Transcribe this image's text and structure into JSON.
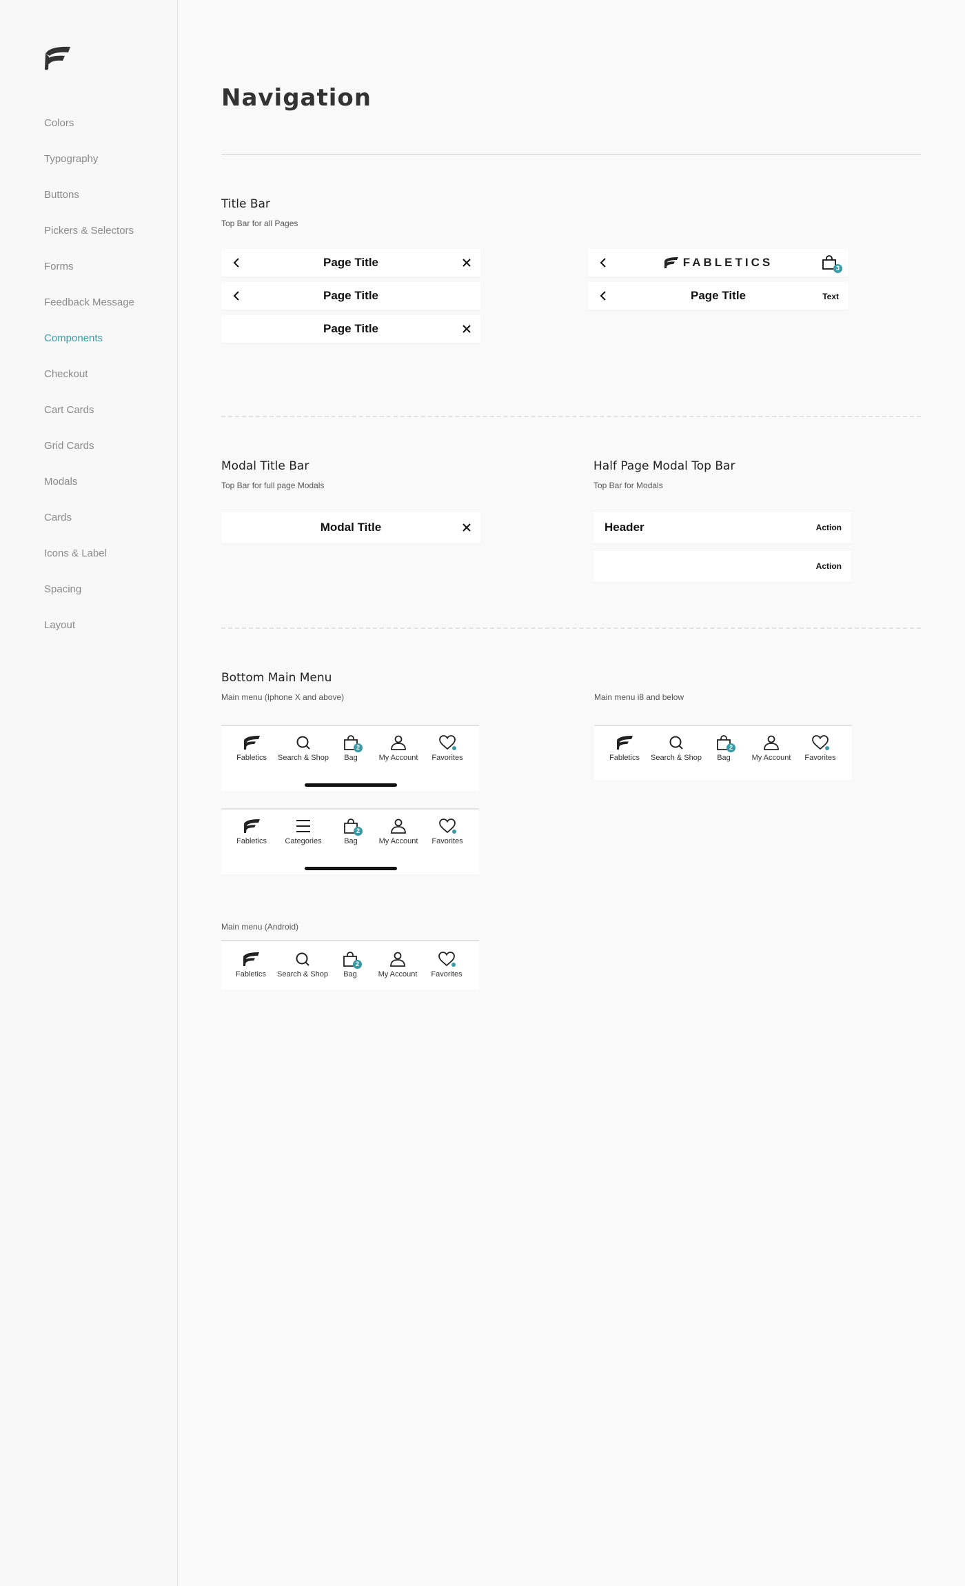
{
  "sidebar": {
    "items": [
      {
        "label": "Colors"
      },
      {
        "label": "Typography"
      },
      {
        "label": "Buttons"
      },
      {
        "label": "Pickers & Selectors"
      },
      {
        "label": "Forms"
      },
      {
        "label": "Feedback Message"
      },
      {
        "label": "Components",
        "active": true
      },
      {
        "label": "Checkout"
      },
      {
        "label": "Cart Cards"
      },
      {
        "label": "Grid Cards"
      },
      {
        "label": "Modals"
      },
      {
        "label": "Cards"
      },
      {
        "label": "Icons & Label"
      },
      {
        "label": "Spacing"
      },
      {
        "label": "Layout"
      }
    ]
  },
  "page": {
    "title": "Navigation"
  },
  "title_bar": {
    "title": "Title Bar",
    "subtitle": "Top Bar for all Pages",
    "page_title": "Page Title",
    "brand": "FABLETICS",
    "bag_count": "3",
    "right_text": "Text"
  },
  "modal_title_bar": {
    "title": "Modal Title Bar",
    "subtitle": "Top Bar for full page Modals",
    "modal_title": "Modal Title"
  },
  "half_modal": {
    "title": "Half Page Modal Top Bar",
    "subtitle": "Top Bar for Modals",
    "header": "Header",
    "action": "Action"
  },
  "bottom_menu": {
    "title": "Bottom Main Menu",
    "iphone_x_label": "Main menu (Iphone X and above)",
    "i8_label": "Main menu i8 and below",
    "android_label": "Main menu (Android)",
    "bag_count": "2",
    "items": {
      "fabletics": "Fabletics",
      "search": "Search & Shop",
      "categories": "Categories",
      "bag": "Bag",
      "account": "My Account",
      "favorites": "Favorites"
    }
  },
  "colors": {
    "accent": "#3a9ba6",
    "text": "#222222",
    "muted": "#8a8a8a"
  }
}
